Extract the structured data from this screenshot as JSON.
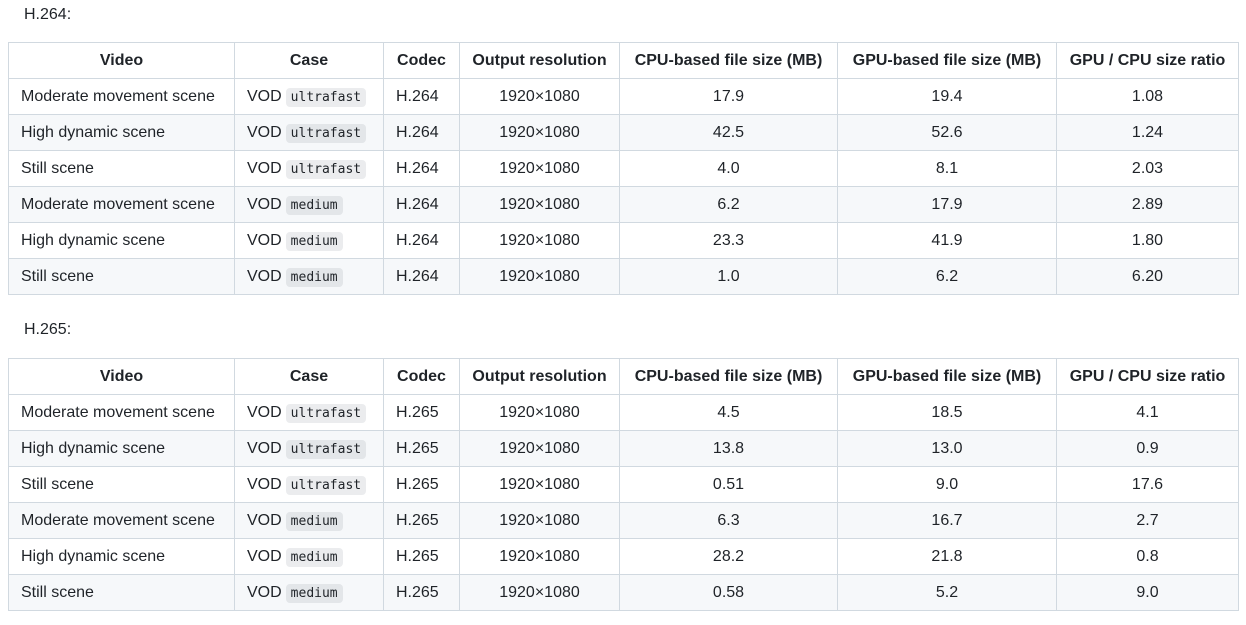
{
  "sections": [
    {
      "heading": "H.264:",
      "columns": [
        "Video",
        "Case",
        "Codec",
        "Output resolution",
        "CPU-based file size (MB)",
        "GPU-based file size (MB)",
        "GPU / CPU size ratio"
      ],
      "rows": [
        {
          "video": "Moderate movement scene",
          "case": "VOD",
          "preset": "ultrafast",
          "codec": "H.264",
          "resolution": "1920×1080",
          "cpu_size": "17.9",
          "gpu_size": "19.4",
          "ratio": "1.08"
        },
        {
          "video": "High dynamic scene",
          "case": "VOD",
          "preset": "ultrafast",
          "codec": "H.264",
          "resolution": "1920×1080",
          "cpu_size": "42.5",
          "gpu_size": "52.6",
          "ratio": "1.24"
        },
        {
          "video": "Still scene",
          "case": "VOD",
          "preset": "ultrafast",
          "codec": "H.264",
          "resolution": "1920×1080",
          "cpu_size": "4.0",
          "gpu_size": "8.1",
          "ratio": "2.03"
        },
        {
          "video": "Moderate movement scene",
          "case": "VOD",
          "preset": "medium",
          "codec": "H.264",
          "resolution": "1920×1080",
          "cpu_size": "6.2",
          "gpu_size": "17.9",
          "ratio": "2.89"
        },
        {
          "video": "High dynamic scene",
          "case": "VOD",
          "preset": "medium",
          "codec": "H.264",
          "resolution": "1920×1080",
          "cpu_size": "23.3",
          "gpu_size": "41.9",
          "ratio": "1.80"
        },
        {
          "video": "Still scene",
          "case": "VOD",
          "preset": "medium",
          "codec": "H.264",
          "resolution": "1920×1080",
          "cpu_size": "1.0",
          "gpu_size": "6.2",
          "ratio": "6.20"
        }
      ]
    },
    {
      "heading": "H.265:",
      "columns": [
        "Video",
        "Case",
        "Codec",
        "Output resolution",
        "CPU-based file size (MB)",
        "GPU-based file size (MB)",
        "GPU / CPU size ratio"
      ],
      "rows": [
        {
          "video": "Moderate movement scene",
          "case": "VOD",
          "preset": "ultrafast",
          "codec": "H.265",
          "resolution": "1920×1080",
          "cpu_size": "4.5",
          "gpu_size": "18.5",
          "ratio": "4.1"
        },
        {
          "video": "High dynamic scene",
          "case": "VOD",
          "preset": "ultrafast",
          "codec": "H.265",
          "resolution": "1920×1080",
          "cpu_size": "13.8",
          "gpu_size": "13.0",
          "ratio": "0.9"
        },
        {
          "video": "Still scene",
          "case": "VOD",
          "preset": "ultrafast",
          "codec": "H.265",
          "resolution": "1920×1080",
          "cpu_size": "0.51",
          "gpu_size": "9.0",
          "ratio": "17.6"
        },
        {
          "video": "Moderate movement scene",
          "case": "VOD",
          "preset": "medium",
          "codec": "H.265",
          "resolution": "1920×1080",
          "cpu_size": "6.3",
          "gpu_size": "16.7",
          "ratio": "2.7"
        },
        {
          "video": "High dynamic scene",
          "case": "VOD",
          "preset": "medium",
          "codec": "H.265",
          "resolution": "1920×1080",
          "cpu_size": "28.2",
          "gpu_size": "21.8",
          "ratio": "0.8"
        },
        {
          "video": "Still scene",
          "case": "VOD",
          "preset": "medium",
          "codec": "H.265",
          "resolution": "1920×1080",
          "cpu_size": "0.58",
          "gpu_size": "5.2",
          "ratio": "9.0"
        }
      ]
    }
  ]
}
